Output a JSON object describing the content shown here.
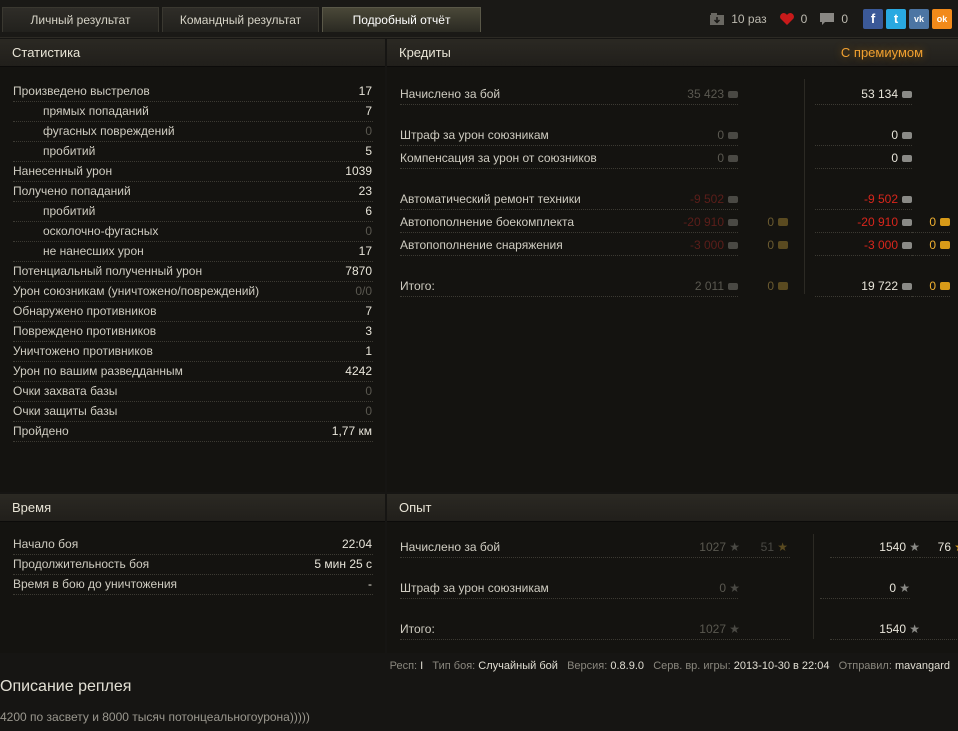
{
  "tabs": [
    "Личный результат",
    "Командный результат",
    "Подробный отчёт"
  ],
  "counters": {
    "views": "10 раз",
    "likes": "0",
    "comments": "0"
  },
  "social": {
    "facebook": "f",
    "twitter": "t",
    "vk": "vk",
    "ok": "ok"
  },
  "stats": {
    "title": "Статистика",
    "rows": [
      {
        "label": "Произведено выстрелов",
        "value": "17"
      },
      {
        "label": "прямых попаданий",
        "value": "7"
      },
      {
        "label": "фугасных повреждений",
        "value": "0"
      },
      {
        "label": "пробитий",
        "value": "5"
      },
      {
        "label": "Нанесенный урон",
        "value": "1039"
      },
      {
        "label": "Получено попаданий",
        "value": "23"
      },
      {
        "label": "пробитий",
        "value": "6"
      },
      {
        "label": "осколочно-фугасных",
        "value": "0"
      },
      {
        "label": "не нанесших урон",
        "value": "17"
      },
      {
        "label": "Потенциальный полученный урон",
        "value": "7870"
      },
      {
        "label": "Урон союзникам (уничтожено/повреждений)",
        "value": "0/0"
      },
      {
        "label": "Обнаружено противников",
        "value": "7"
      },
      {
        "label": "Повреждено противников",
        "value": "3"
      },
      {
        "label": "Уничтожено противников",
        "value": "1"
      },
      {
        "label": "Урон по вашим разведданным",
        "value": "4242"
      },
      {
        "label": "Очки захвата базы",
        "value": "0"
      },
      {
        "label": "Очки защиты базы",
        "value": "0"
      },
      {
        "label": "Пройдено",
        "value": "1,77 км"
      }
    ]
  },
  "credits": {
    "title": "Кредиты",
    "premium_label": "С премиумом",
    "rows": [
      {
        "label": "Начислено за бой",
        "base": "35 423",
        "premium": "53 134"
      },
      {
        "label": "Штраф за урон союзникам",
        "base": "0",
        "premium": "0"
      },
      {
        "label": "Компенсация за урон от союзников",
        "base": "0",
        "premium": "0"
      },
      {
        "label": "Автоматический ремонт техники",
        "base": "-9 502",
        "premium": "-9 502"
      },
      {
        "label": "Автопополнение боекомплекта",
        "base": "-20 910",
        "base_gold": "0",
        "premium": "-20 910",
        "premium_gold": "0"
      },
      {
        "label": "Автопополнение снаряжения",
        "base": "-3 000",
        "base_gold": "0",
        "premium": "-3 000",
        "premium_gold": "0"
      },
      {
        "label": "Итого:",
        "base": "2 011",
        "base_gold": "0",
        "premium": "19 722",
        "premium_gold": "0"
      }
    ]
  },
  "time": {
    "title": "Время",
    "rows": [
      {
        "label": "Начало боя",
        "value": "22:04"
      },
      {
        "label": "Продолжительность боя",
        "value": "5 мин 25 с"
      },
      {
        "label": "Время в бою до уничтожения",
        "value": "-"
      }
    ]
  },
  "experience": {
    "title": "Опыт",
    "rows": [
      {
        "label": "Начислено за бой",
        "base": "1027",
        "base_free": "51",
        "premium": "1540",
        "premium_free": "76"
      },
      {
        "label": "Штраф за урон союзникам",
        "base": "0",
        "premium": "0"
      },
      {
        "label": "Итого:",
        "base": "1027",
        "premium": "1540"
      }
    ]
  },
  "info": {
    "resp_label": "Респ:",
    "resp": "I",
    "battle_type_label": "Тип боя:",
    "battle_type": "Случайный бой",
    "version_label": "Версия:",
    "version": "0.8.9.0",
    "server_time_label": "Серв. вр. игры:",
    "server_time": "2013-10-30 в 22:04",
    "sent_label": "Отправил:",
    "sent_by": "mavangard"
  },
  "description": {
    "title": "Описание реплея",
    "text": "4200 по засвету и 8000 тысяч потонцеальногоурона)))))"
  },
  "colors": {
    "accent_premium": "#f0a030",
    "negative": "#d8261c",
    "gold": "#d89a18"
  }
}
